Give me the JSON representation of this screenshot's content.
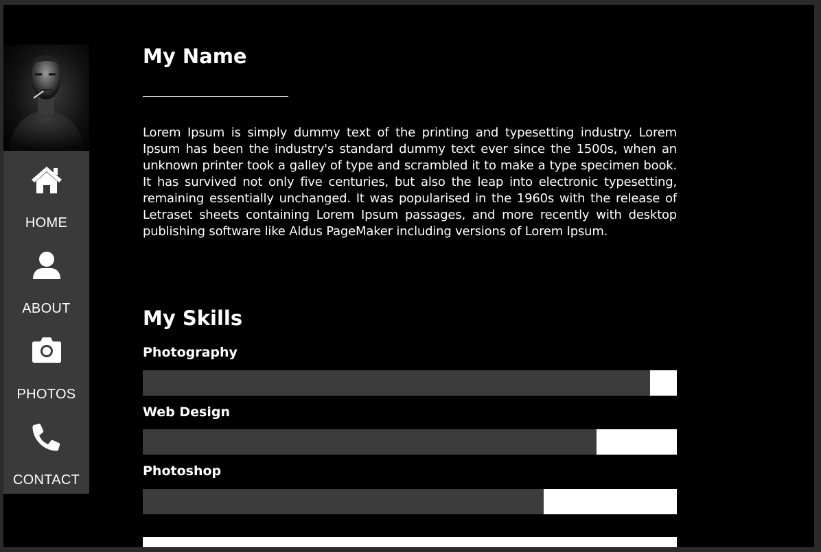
{
  "nav": {
    "items": [
      {
        "label": "HOME",
        "icon": "home-icon"
      },
      {
        "label": "ABOUT",
        "icon": "user-icon"
      },
      {
        "label": "PHOTOS",
        "icon": "camera-icon"
      },
      {
        "label": "CONTACT",
        "icon": "phone-icon"
      }
    ]
  },
  "profile": {
    "name": "My Name",
    "bio": "Lorem Ipsum is simply dummy text of the printing and typesetting industry. Lorem Ipsum has been the industry's standard dummy text ever since the 1500s, when an unknown printer took a galley of type and scrambled it to make a type specimen book. It has survived not only five centuries, but also the leap into electronic typesetting, remaining essentially unchanged. It was popularised in the 1960s with the release of Letraset sheets containing Lorem Ipsum passages, and more recently with desktop publishing software like Aldus PageMaker including versions of Lorem Ipsum."
  },
  "skills": {
    "title": "My Skills",
    "items": [
      {
        "name": "Photography",
        "level": 0.95
      },
      {
        "name": "Web Design",
        "level": 0.85
      },
      {
        "name": "Photoshop",
        "level": 0.75
      }
    ]
  },
  "colors": {
    "background": "#000000",
    "sidebar": "#3a3a3a",
    "bar_fill": "#3c3c3c",
    "bar_track": "#ffffff",
    "text": "#ffffff"
  }
}
